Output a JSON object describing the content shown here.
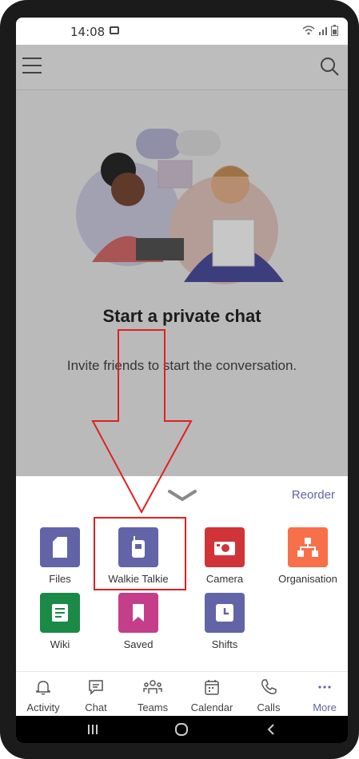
{
  "status_bar": {
    "time": "14:08"
  },
  "empty_state": {
    "title": "Start a private chat",
    "subtitle": "Invite friends to start the conversation."
  },
  "sheet": {
    "reorder_label": "Reorder",
    "apps": [
      {
        "label": "Files",
        "color": "#6264a7"
      },
      {
        "label": "Walkie Talkie",
        "color": "#6264a7"
      },
      {
        "label": "Camera",
        "color": "#d13438"
      },
      {
        "label": "Organisation",
        "color": "#f7704a"
      },
      {
        "label": "Wiki",
        "color": "#1b8a47"
      },
      {
        "label": "Saved",
        "color": "#c43e8a"
      },
      {
        "label": "Shifts",
        "color": "#6264a7"
      }
    ]
  },
  "bottom_nav": [
    {
      "label": "Activity",
      "icon": "bell-icon"
    },
    {
      "label": "Chat",
      "icon": "chat-icon"
    },
    {
      "label": "Teams",
      "icon": "teams-icon"
    },
    {
      "label": "Calendar",
      "icon": "calendar-icon"
    },
    {
      "label": "Calls",
      "icon": "phone-icon"
    },
    {
      "label": "More",
      "icon": "more-icon"
    }
  ],
  "colors": {
    "accent": "#6264a7",
    "highlight_red": "#e02020"
  }
}
